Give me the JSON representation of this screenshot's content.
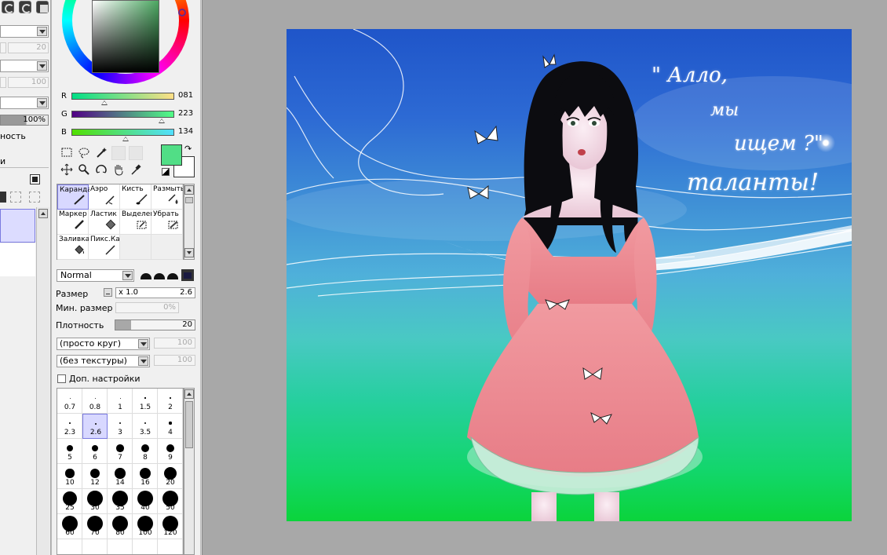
{
  "colors": {
    "foreground": "#51de86",
    "background": "#ffffff",
    "selection": "#d8d8ff",
    "canvas_top": "#1f55c9",
    "canvas_bottom": "#0bd43b",
    "dress": "#ef8a8e"
  },
  "left_panel": {
    "fields": [
      "20",
      "100"
    ],
    "opacity": "100%",
    "label_cut": "ность",
    "label_cut2": "и"
  },
  "color_panel": {
    "r_label": "R",
    "r_value": "081",
    "r_fraction": 0.318,
    "g_label": "G",
    "g_value": "223",
    "g_fraction": 0.875,
    "b_label": "B",
    "b_value": "134",
    "b_fraction": 0.525
  },
  "tools": {
    "icons": [
      "select-rect-icon",
      "lasso-icon",
      "magic-wand-icon",
      "move-icon",
      "zoom-icon",
      "rotate-icon",
      "hand-icon",
      "eyedropper-icon"
    ]
  },
  "brushes": [
    {
      "label": "Каранда",
      "icon": "✎",
      "selected": true
    },
    {
      "label": "Аэро",
      "icon": "✈",
      "selected": false
    },
    {
      "label": "Кисть",
      "icon": "🖌",
      "selected": false
    },
    {
      "label": "Размыть",
      "icon": "💧",
      "selected": false
    },
    {
      "label": "Маркер",
      "icon": "✐",
      "selected": false
    },
    {
      "label": "Ластик",
      "icon": "◆",
      "selected": false
    },
    {
      "label": "Выделен",
      "icon": "▦",
      "selected": false
    },
    {
      "label": "Убрать",
      "icon": "▩",
      "selected": false
    },
    {
      "label": "Заливка",
      "icon": "◈",
      "selected": false
    },
    {
      "label": "Пикс.Ка",
      "icon": "✎",
      "selected": false
    }
  ],
  "brush_props": {
    "blend_mode": "Normal",
    "size_label": "Размер",
    "size_multiplier": "x 1.0",
    "size_value": "2.6",
    "min_size_label": "Мин. размер",
    "min_size_value": "0%",
    "density_label": "Плотность",
    "density_value": "20",
    "density_fraction": 0.2,
    "shape_select": "(просто круг)",
    "shape_value": "100",
    "texture_select": "(без текстуры)",
    "texture_value": "100",
    "advanced_label": "Доп. настройки"
  },
  "sizes": [
    "0.7",
    "0.8",
    "1",
    "1.5",
    "2",
    "2.3",
    "2.6",
    "3",
    "3.5",
    "4",
    "5",
    "6",
    "7",
    "8",
    "9",
    "10",
    "12",
    "14",
    "16",
    "20",
    "25",
    "30",
    "35",
    "40",
    "50",
    "60",
    "70",
    "80",
    "100",
    "120",
    "",
    "",
    "",
    "",
    ""
  ],
  "selected_size": "2.6",
  "artwork": {
    "quote_line1": "\" Алло,",
    "quote_line2": "мы",
    "quote_line3": "ищем ?\"",
    "quote_line4": "таланты!"
  }
}
